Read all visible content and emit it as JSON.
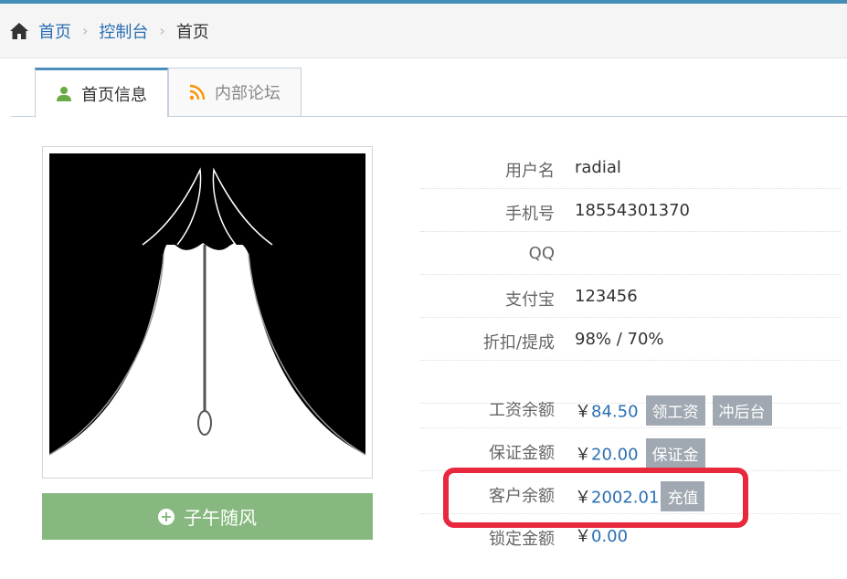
{
  "breadcrumb": {
    "home": "首页",
    "console": "控制台",
    "current": "首页",
    "separator": "›"
  },
  "tabs": [
    {
      "label": "首页信息",
      "active": true,
      "icon": "user-icon"
    },
    {
      "label": "内部论坛",
      "active": false,
      "icon": "rss-icon"
    }
  ],
  "profile": {
    "display_name": "子午随风"
  },
  "info": {
    "username": {
      "label": "用户名",
      "value": "radial"
    },
    "phone": {
      "label": "手机号",
      "value": "18554301370"
    },
    "qq": {
      "label": "QQ",
      "value": ""
    },
    "alipay": {
      "label": "支付宝",
      "value": "123456"
    },
    "discount": {
      "label": "折扣/提成",
      "value": "98% / 70%"
    },
    "salary": {
      "label": "工资余额",
      "currency": "￥",
      "amount": "84.50",
      "btn_withdraw": "领工资",
      "btn_topup": "冲后台"
    },
    "deposit": {
      "label": "保证金额",
      "currency": "￥",
      "amount": "20.00",
      "btn": "保证金"
    },
    "customer": {
      "label": "客户余额",
      "currency": "￥",
      "amount": "2002.01",
      "btn": "充值"
    },
    "locked": {
      "label": "锁定金额",
      "currency": "￥",
      "amount": "0.00"
    }
  },
  "colors": {
    "accent": "#438eb9",
    "link": "#2a6fb3",
    "success_button": "#87b87f",
    "tag_button": "#a0a8b2",
    "currency_symbol": "#d15b47",
    "highlight": "#e8293d"
  }
}
